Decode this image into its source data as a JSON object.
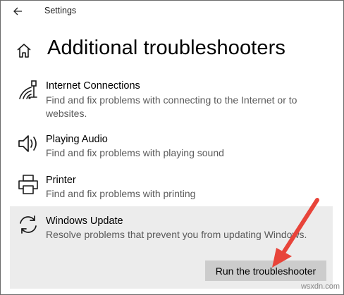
{
  "window": {
    "title": "Settings"
  },
  "page": {
    "title": "Additional troubleshooters"
  },
  "items": [
    {
      "icon": "wifi-ethernet-icon",
      "name": "Internet Connections",
      "description": "Find and fix problems with connecting to the Internet or to websites."
    },
    {
      "icon": "speaker-icon",
      "name": "Playing Audio",
      "description": "Find and fix problems with playing sound"
    },
    {
      "icon": "printer-icon",
      "name": "Printer",
      "description": "Find and fix problems with printing"
    },
    {
      "icon": "sync-icon",
      "name": "Windows Update",
      "description": "Resolve problems that prevent you from updating Windows.",
      "selected": true
    }
  ],
  "actions": {
    "run_label": "Run the troubleshooter"
  },
  "annotation": {
    "arrow_color": "#e8443a"
  },
  "watermark": "wsxdn.com"
}
